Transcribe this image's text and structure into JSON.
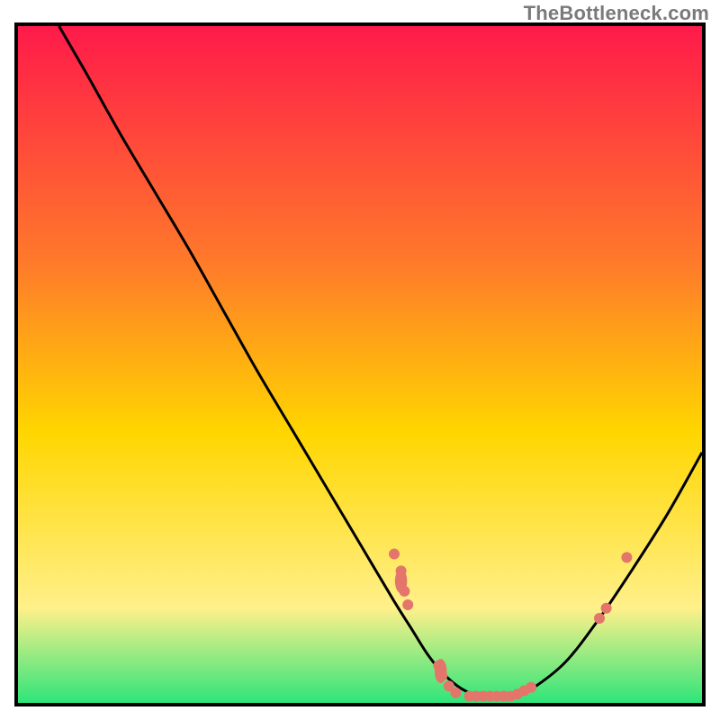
{
  "watermark": "TheBottleneck.com",
  "colors": {
    "gradient_top": "#ff1a4a",
    "gradient_mid1": "#ff7a2a",
    "gradient_mid2": "#ffd600",
    "gradient_mid3": "#fff08a",
    "gradient_bottom": "#2ee57a",
    "curve": "#000000",
    "marker_fill": "#e3756b",
    "border": "#000000"
  },
  "chart_data": {
    "type": "line",
    "title": "",
    "xlabel": "",
    "ylabel": "",
    "xlim": [
      0,
      100
    ],
    "ylim": [
      0,
      100
    ],
    "grid": false,
    "series": [
      {
        "name": "bottleneck-curve",
        "x": [
          6,
          10,
          15,
          20,
          25,
          30,
          35,
          40,
          45,
          50,
          55,
          57.5,
          60,
          62.5,
          65,
          67.5,
          70,
          72.5,
          75,
          80,
          85,
          90,
          95,
          100
        ],
        "y": [
          100,
          93,
          84,
          75.5,
          67,
          58,
          49,
          40.5,
          32,
          23.5,
          15,
          11,
          7,
          4,
          2,
          1,
          1,
          1,
          2,
          6,
          12.5,
          20,
          28,
          37
        ]
      }
    ],
    "markers": [
      {
        "x": 55.0,
        "y": 22.0
      },
      {
        "x": 56.0,
        "y": 19.5
      },
      {
        "x": 56.5,
        "y": 16.5
      },
      {
        "x": 57.0,
        "y": 14.5
      },
      {
        "x": 61.5,
        "y": 5.5
      },
      {
        "x": 62.0,
        "y": 4.0
      },
      {
        "x": 63.0,
        "y": 2.5
      },
      {
        "x": 64.0,
        "y": 1.5
      },
      {
        "x": 66.0,
        "y": 1.0
      },
      {
        "x": 67.0,
        "y": 1.0
      },
      {
        "x": 68.0,
        "y": 1.0
      },
      {
        "x": 69.0,
        "y": 1.0
      },
      {
        "x": 70.0,
        "y": 1.0
      },
      {
        "x": 71.0,
        "y": 1.0
      },
      {
        "x": 72.0,
        "y": 1.0
      },
      {
        "x": 73.0,
        "y": 1.3
      },
      {
        "x": 74.0,
        "y": 1.8
      },
      {
        "x": 75.0,
        "y": 2.3
      },
      {
        "x": 85.0,
        "y": 12.5
      },
      {
        "x": 86.0,
        "y": 14.0
      },
      {
        "x": 89.0,
        "y": 21.5
      }
    ],
    "marker_big": [
      {
        "x": 56.0,
        "y": 18.0,
        "r": 9
      },
      {
        "x": 61.8,
        "y": 4.7,
        "r": 9
      }
    ]
  }
}
